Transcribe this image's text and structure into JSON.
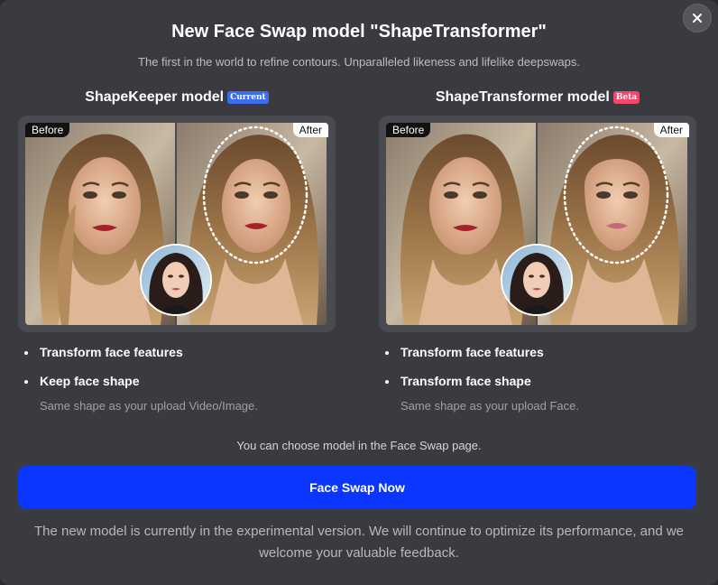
{
  "dialog": {
    "title": "New Face Swap model \"ShapeTransformer\"",
    "subtitle": "The first in the world to refine contours. Unparalleled likeness and lifelike deepswaps.",
    "close_icon": "close-icon"
  },
  "models": [
    {
      "name": "ShapeKeeper model",
      "badge": "Current",
      "badge_color": "#3c6cf0",
      "before_label": "Before",
      "after_label": "After",
      "features": [
        "Transform face features",
        "Keep face shape"
      ],
      "description": "Same shape as your upload Video/Image."
    },
    {
      "name": "ShapeTransformer model",
      "badge": "Beta",
      "badge_color": "#f1486b",
      "before_label": "Before",
      "after_label": "After",
      "features": [
        "Transform face features",
        "Transform face shape"
      ],
      "description": "Same shape as your upload Face."
    }
  ],
  "hint": "You can choose model in the Face Swap page.",
  "cta_label": "Face Swap Now",
  "cta_color": "#0a36ff",
  "footer": "The new model is currently in the experimental version. We will continue to optimize its performance, and we welcome your valuable feedback."
}
